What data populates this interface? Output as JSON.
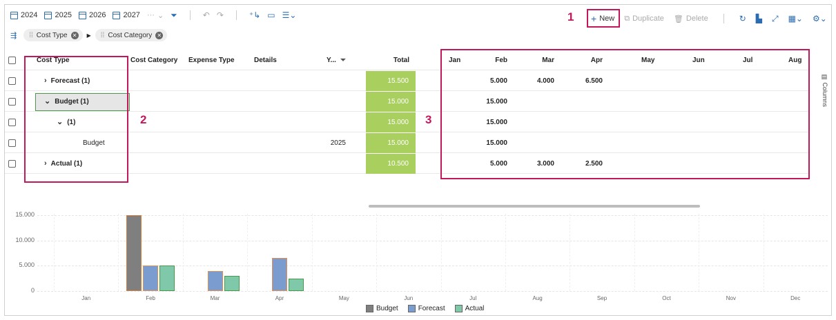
{
  "toolbar": {
    "years": [
      "2024",
      "2025",
      "2026",
      "2027"
    ],
    "more_label": "···",
    "new_label": "New",
    "duplicate_label": "Duplicate",
    "delete_label": "Delete"
  },
  "group_chips": [
    {
      "label": "Cost Type"
    },
    {
      "label": "Cost Category"
    }
  ],
  "grid": {
    "headers": {
      "cost_type": "Cost Type",
      "cost_category": "Cost Category",
      "expense_type": "Expense Type",
      "details": "Details",
      "year": "Y...",
      "total": "Total",
      "months": [
        "Jan",
        "Feb",
        "Mar",
        "Apr",
        "May",
        "Jun",
        "Jul",
        "Aug"
      ]
    },
    "rows": [
      {
        "label": "Forecast (1)",
        "chevron": "›",
        "year": "",
        "total": "15.500",
        "months": [
          "",
          "5.000",
          "4.000",
          "6.500",
          "",
          "",
          "",
          ""
        ]
      },
      {
        "label": "Budget (1)",
        "chevron": "⌄",
        "year": "",
        "total": "15.000",
        "months": [
          "",
          "15.000",
          "",
          "",
          "",
          "",
          "",
          ""
        ]
      },
      {
        "label": "(1)",
        "chevron": "⌄",
        "year": "",
        "total": "15.000",
        "months": [
          "",
          "15.000",
          "",
          "",
          "",
          "",
          "",
          ""
        ]
      },
      {
        "label": "Budget",
        "chevron": "",
        "year": "2025",
        "total": "15.000",
        "months": [
          "",
          "15.000",
          "",
          "",
          "",
          "",
          "",
          ""
        ]
      },
      {
        "label": "Actual (1)",
        "chevron": "›",
        "year": "",
        "total": "10.500",
        "months": [
          "",
          "5.000",
          "3.000",
          "2.500",
          "",
          "",
          "",
          ""
        ]
      }
    ]
  },
  "columns_tab": "Columns",
  "annotations": [
    "1",
    "2",
    "3"
  ],
  "chart_data": {
    "type": "bar",
    "categories": [
      "Jan",
      "Feb",
      "Mar",
      "Apr",
      "May",
      "Jun",
      "Jul",
      "Aug",
      "Sep",
      "Oct",
      "Nov",
      "Dec"
    ],
    "series": [
      {
        "name": "Budget",
        "color": "#7f7f7f",
        "values": [
          0,
          15000,
          0,
          0,
          0,
          0,
          0,
          0,
          0,
          0,
          0,
          0
        ]
      },
      {
        "name": "Forecast",
        "color": "#7b9ccf",
        "values": [
          0,
          5000,
          4000,
          6500,
          0,
          0,
          0,
          0,
          0,
          0,
          0,
          0
        ]
      },
      {
        "name": "Actual",
        "color": "#7fc8a9",
        "values": [
          0,
          5000,
          3000,
          2500,
          0,
          0,
          0,
          0,
          0,
          0,
          0,
          0
        ]
      }
    ],
    "yticks": [
      "15.000",
      "10.000",
      "5.000",
      "0"
    ],
    "ylim": [
      0,
      15000
    ],
    "legend_position": "bottom"
  }
}
